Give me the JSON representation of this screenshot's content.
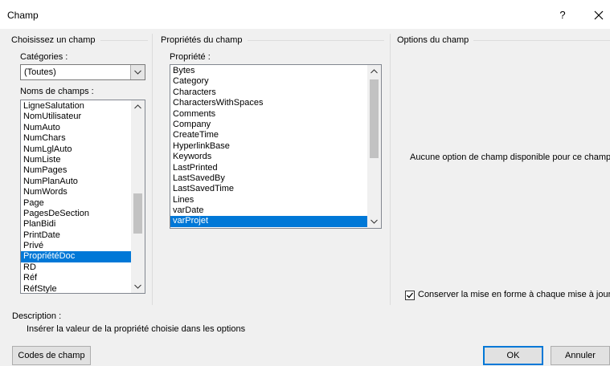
{
  "window": {
    "title": "Champ",
    "help": "?",
    "close": "✕"
  },
  "left_panel": {
    "group_title": "Choisissez un champ",
    "categories_label": "Catégories :",
    "categories_value": "(Toutes)",
    "fields_label": "Noms de champs :",
    "fields": [
      "LigneSalutation",
      "NomUtilisateur",
      "NumAuto",
      "NumChars",
      "NumLglAuto",
      "NumListe",
      "NumPages",
      "NumPlanAuto",
      "NumWords",
      "Page",
      "PagesDeSection",
      "PlanBidi",
      "PrintDate",
      "Privé",
      "PropriétéDoc",
      "RD",
      "Réf",
      "RéfStyle"
    ],
    "selected_field": "PropriétéDoc"
  },
  "middle_panel": {
    "group_title": "Propriétés du champ",
    "property_label": "Propriété :",
    "properties": [
      "Bytes",
      "Category",
      "Characters",
      "CharactersWithSpaces",
      "Comments",
      "Company",
      "CreateTime",
      "HyperlinkBase",
      "Keywords",
      "LastPrinted",
      "LastSavedBy",
      "LastSavedTime",
      "Lines",
      "varDate",
      "varProjet"
    ],
    "selected_property": "varProjet"
  },
  "right_panel": {
    "group_title": "Options du champ",
    "no_options_text": "Aucune option de champ disponible pour ce champ",
    "preserve_format_label": "Conserver la mise en forme à chaque mise à jour",
    "preserve_format_checked": true
  },
  "description": {
    "label": "Description :",
    "text": "Insérer la valeur de la propriété choisie dans les options"
  },
  "buttons": {
    "field_codes": "Codes de champ",
    "ok": "OK",
    "cancel": "Annuler"
  },
  "colors": {
    "selection": "#0078d7",
    "background": "#f0f0f0"
  }
}
